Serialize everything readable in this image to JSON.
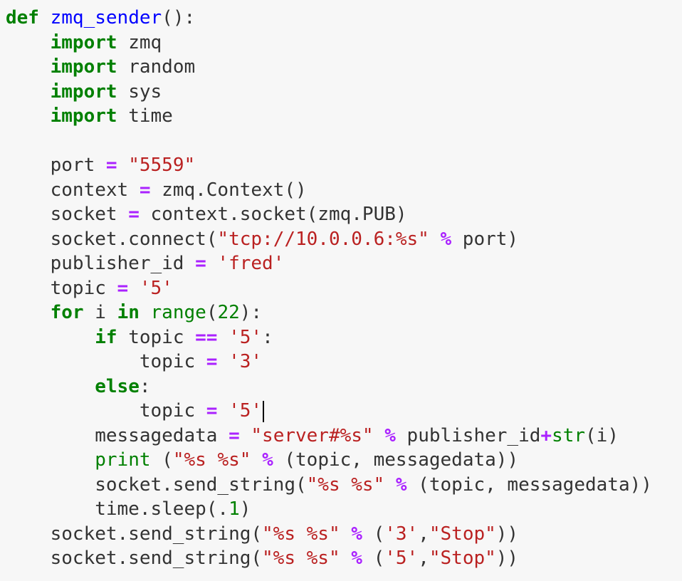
{
  "editor": {
    "language": "python",
    "colors": {
      "background": "#f7f7f7",
      "keyword": "#008000",
      "function_name": "#0000ff",
      "string": "#ba2121",
      "operator": "#aa22ff",
      "builtin": "#008000",
      "number": "#008000",
      "plain": "#333333"
    },
    "caret": {
      "line_index": 16
    },
    "lines": [
      {
        "tokens": [
          {
            "t": "kw",
            "v": "def"
          },
          {
            "t": "plain",
            "v": " "
          },
          {
            "t": "def",
            "v": "zmq_sender"
          },
          {
            "t": "plain",
            "v": "():"
          }
        ]
      },
      {
        "tokens": [
          {
            "t": "plain",
            "v": "    "
          },
          {
            "t": "kw",
            "v": "import"
          },
          {
            "t": "plain",
            "v": " zmq"
          }
        ]
      },
      {
        "tokens": [
          {
            "t": "plain",
            "v": "    "
          },
          {
            "t": "kw",
            "v": "import"
          },
          {
            "t": "plain",
            "v": " random"
          }
        ]
      },
      {
        "tokens": [
          {
            "t": "plain",
            "v": "    "
          },
          {
            "t": "kw",
            "v": "import"
          },
          {
            "t": "plain",
            "v": " sys"
          }
        ]
      },
      {
        "tokens": [
          {
            "t": "plain",
            "v": "    "
          },
          {
            "t": "kw",
            "v": "import"
          },
          {
            "t": "plain",
            "v": " time"
          }
        ]
      },
      {
        "tokens": [
          {
            "t": "plain",
            "v": ""
          }
        ]
      },
      {
        "tokens": [
          {
            "t": "plain",
            "v": "    port "
          },
          {
            "t": "op",
            "v": "="
          },
          {
            "t": "plain",
            "v": " "
          },
          {
            "t": "str",
            "v": "\"5559\""
          }
        ]
      },
      {
        "tokens": [
          {
            "t": "plain",
            "v": "    context "
          },
          {
            "t": "op",
            "v": "="
          },
          {
            "t": "plain",
            "v": " zmq.Context()"
          }
        ]
      },
      {
        "tokens": [
          {
            "t": "plain",
            "v": "    socket "
          },
          {
            "t": "op",
            "v": "="
          },
          {
            "t": "plain",
            "v": " context.socket(zmq.PUB)"
          }
        ]
      },
      {
        "tokens": [
          {
            "t": "plain",
            "v": "    socket.connect("
          },
          {
            "t": "str",
            "v": "\"tcp://10.0.0.6:%s\""
          },
          {
            "t": "plain",
            "v": " "
          },
          {
            "t": "op",
            "v": "%"
          },
          {
            "t": "plain",
            "v": " port)"
          }
        ]
      },
      {
        "tokens": [
          {
            "t": "plain",
            "v": "    publisher_id "
          },
          {
            "t": "op",
            "v": "="
          },
          {
            "t": "plain",
            "v": " "
          },
          {
            "t": "str",
            "v": "'fred'"
          }
        ]
      },
      {
        "tokens": [
          {
            "t": "plain",
            "v": "    topic "
          },
          {
            "t": "op",
            "v": "="
          },
          {
            "t": "plain",
            "v": " "
          },
          {
            "t": "str",
            "v": "'5'"
          }
        ]
      },
      {
        "tokens": [
          {
            "t": "plain",
            "v": "    "
          },
          {
            "t": "kw",
            "v": "for"
          },
          {
            "t": "plain",
            "v": " i "
          },
          {
            "t": "kw",
            "v": "in"
          },
          {
            "t": "plain",
            "v": " "
          },
          {
            "t": "builtin",
            "v": "range"
          },
          {
            "t": "plain",
            "v": "("
          },
          {
            "t": "num",
            "v": "22"
          },
          {
            "t": "plain",
            "v": "):"
          }
        ]
      },
      {
        "tokens": [
          {
            "t": "plain",
            "v": "        "
          },
          {
            "t": "kw",
            "v": "if"
          },
          {
            "t": "plain",
            "v": " topic "
          },
          {
            "t": "op",
            "v": "=="
          },
          {
            "t": "plain",
            "v": " "
          },
          {
            "t": "str",
            "v": "'5'"
          },
          {
            "t": "plain",
            "v": ":"
          }
        ]
      },
      {
        "tokens": [
          {
            "t": "plain",
            "v": "            topic "
          },
          {
            "t": "op",
            "v": "="
          },
          {
            "t": "plain",
            "v": " "
          },
          {
            "t": "str",
            "v": "'3'"
          }
        ]
      },
      {
        "tokens": [
          {
            "t": "plain",
            "v": "        "
          },
          {
            "t": "kw",
            "v": "else"
          },
          {
            "t": "plain",
            "v": ":"
          }
        ]
      },
      {
        "tokens": [
          {
            "t": "plain",
            "v": "            topic "
          },
          {
            "t": "op",
            "v": "="
          },
          {
            "t": "plain",
            "v": " "
          },
          {
            "t": "str",
            "v": "'5'"
          }
        ]
      },
      {
        "tokens": [
          {
            "t": "plain",
            "v": "        messagedata "
          },
          {
            "t": "op",
            "v": "="
          },
          {
            "t": "plain",
            "v": " "
          },
          {
            "t": "str",
            "v": "\"server#%s\""
          },
          {
            "t": "plain",
            "v": " "
          },
          {
            "t": "op",
            "v": "%"
          },
          {
            "t": "plain",
            "v": " publisher_id"
          },
          {
            "t": "op",
            "v": "+"
          },
          {
            "t": "builtin",
            "v": "str"
          },
          {
            "t": "plain",
            "v": "(i)"
          }
        ]
      },
      {
        "tokens": [
          {
            "t": "plain",
            "v": "        "
          },
          {
            "t": "builtin",
            "v": "print"
          },
          {
            "t": "plain",
            "v": " ("
          },
          {
            "t": "str",
            "v": "\"%s %s\""
          },
          {
            "t": "plain",
            "v": " "
          },
          {
            "t": "op",
            "v": "%"
          },
          {
            "t": "plain",
            "v": " (topic, messagedata))"
          }
        ]
      },
      {
        "tokens": [
          {
            "t": "plain",
            "v": "        socket.send_string("
          },
          {
            "t": "str",
            "v": "\"%s %s\""
          },
          {
            "t": "plain",
            "v": " "
          },
          {
            "t": "op",
            "v": "%"
          },
          {
            "t": "plain",
            "v": " (topic, messagedata))"
          }
        ]
      },
      {
        "tokens": [
          {
            "t": "plain",
            "v": "        time.sleep(."
          },
          {
            "t": "num",
            "v": "1"
          },
          {
            "t": "plain",
            "v": ")"
          }
        ]
      },
      {
        "tokens": [
          {
            "t": "plain",
            "v": "    socket.send_string("
          },
          {
            "t": "str",
            "v": "\"%s %s\""
          },
          {
            "t": "plain",
            "v": " "
          },
          {
            "t": "op",
            "v": "%"
          },
          {
            "t": "plain",
            "v": " ("
          },
          {
            "t": "str",
            "v": "'3'"
          },
          {
            "t": "plain",
            "v": ","
          },
          {
            "t": "str",
            "v": "\"Stop\""
          },
          {
            "t": "plain",
            "v": "))"
          }
        ]
      },
      {
        "tokens": [
          {
            "t": "plain",
            "v": "    socket.send_string("
          },
          {
            "t": "str",
            "v": "\"%s %s\""
          },
          {
            "t": "plain",
            "v": " "
          },
          {
            "t": "op",
            "v": "%"
          },
          {
            "t": "plain",
            "v": " ("
          },
          {
            "t": "str",
            "v": "'5'"
          },
          {
            "t": "plain",
            "v": ","
          },
          {
            "t": "str",
            "v": "\"Stop\""
          },
          {
            "t": "plain",
            "v": "))"
          }
        ]
      }
    ]
  }
}
